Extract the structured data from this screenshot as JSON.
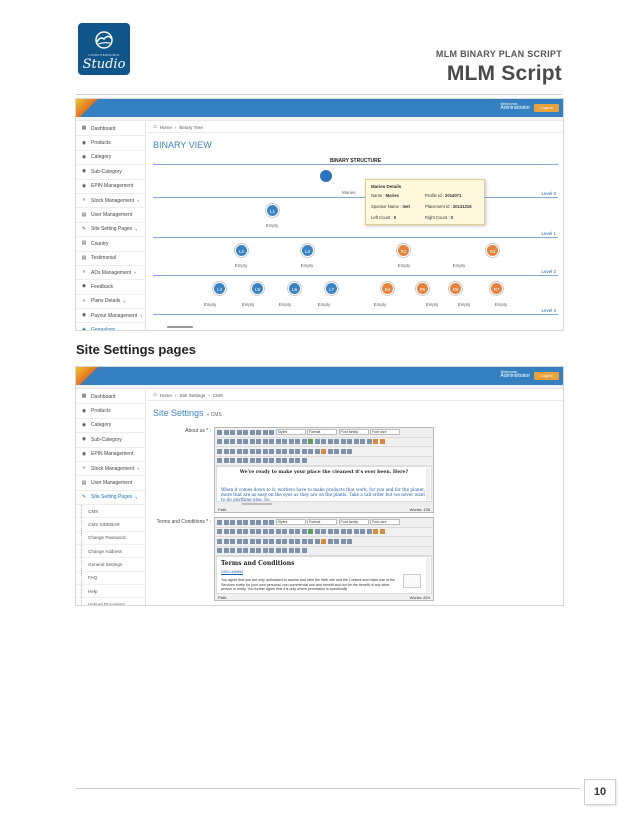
{
  "brand": {
    "company": "COMPUTERWORLD",
    "product": "Studio"
  },
  "header": {
    "subtitle": "MLM BINARY PLAN SCRIPT",
    "title": "MLM Script"
  },
  "topbar": {
    "welcome": "Welcome,",
    "user": "Administrator",
    "logout": "Logout"
  },
  "sidebar1": [
    {
      "icon": "dashboard-icon",
      "label": "Dashboard"
    },
    {
      "icon": "eye-icon",
      "label": "Products"
    },
    {
      "icon": "eye-icon",
      "label": "Category"
    },
    {
      "icon": "eye-icon",
      "label": "Sub-Category"
    },
    {
      "icon": "eye-icon",
      "label": "EPIN Management"
    },
    {
      "icon": "chevrons-icon",
      "label": "Stock Management",
      "caret": "˅"
    },
    {
      "icon": "list-icon",
      "label": "User Management"
    },
    {
      "icon": "edit-icon",
      "label": "Site Setting Pages",
      "caret": "˅"
    },
    {
      "icon": "list-icon",
      "label": "Country"
    },
    {
      "icon": "list-icon",
      "label": "Testimonial"
    },
    {
      "icon": "chevrons-icon",
      "label": "ADs Management",
      "caret": "˅"
    },
    {
      "icon": "tag-icon",
      "label": "Feedback"
    },
    {
      "icon": "chevrons-icon",
      "label": "Plans Details",
      "caret": "˅"
    },
    {
      "icon": "eye-icon",
      "label": "Payout Management",
      "caret": "˅"
    },
    {
      "icon": "eye-icon",
      "label": "Genealogy",
      "caret": "˅",
      "active": true
    }
  ],
  "binary": {
    "breadcrumb": {
      "home": "Home",
      "current": "Binary Tree"
    },
    "page_title": "BINARY VIEW",
    "structure_title": "BINARY STRUCTURE",
    "root_label": "Maries",
    "levels": [
      "Level 0",
      "Level 1",
      "Level 2",
      "Level 3"
    ],
    "empty": "Empty",
    "popup": {
      "title": "Maries Details",
      "name_label": "Name :",
      "name": "Maries",
      "profile_label": "Profile Id :",
      "profile": "2014071",
      "sponsor_label": "Sponsor Name :",
      "sponsor": "Inet",
      "placement_label": "Placement Id :",
      "placement": "20131216",
      "left_label": "Left Count :",
      "left": "0",
      "right_label": "Right Count :",
      "right": "0"
    },
    "nodes": {
      "l1": "L1",
      "l2": "L2",
      "l3": "L3",
      "r2": "R2",
      "r3": "R3",
      "l4": "L4",
      "l5": "L5",
      "l6": "L6",
      "l7": "L7",
      "r4": "R4",
      "r5": "R5",
      "r6": "R6",
      "r7": "R7"
    }
  },
  "section_title": "Site Settings pages",
  "sidebar2": [
    {
      "icon": "dashboard-icon",
      "label": "Dashboard"
    },
    {
      "icon": "eye-icon",
      "label": "Products"
    },
    {
      "icon": "eye-icon",
      "label": "Category"
    },
    {
      "icon": "eye-icon",
      "label": "Sub-Category"
    },
    {
      "icon": "eye-icon",
      "label": "EPIN Management"
    },
    {
      "icon": "chevrons-icon",
      "label": "Stock Management",
      "caret": "˅"
    },
    {
      "icon": "list-icon",
      "label": "User Management"
    },
    {
      "icon": "edit-icon",
      "label": "Site Setting Pages",
      "caret": "˅",
      "active": true
    }
  ],
  "sidebar2_sub": [
    "CMS",
    "CMS SIDEBAR",
    "Change Password",
    "Change Address",
    "General Settings",
    "FAQ",
    "Help",
    "Upload Document"
  ],
  "cms": {
    "breadcrumb": {
      "home": "Home",
      "mid": "Site Settings",
      "current": "CMS"
    },
    "page_title": "Site Settings",
    "page_sub": "» CMS",
    "about_label": "About us * :",
    "terms_label": "Terms and Conditions * :",
    "toolbar": {
      "styles": "Styles",
      "format": "Format",
      "font": "Font family",
      "size": "Font size"
    },
    "about_heading": "We're ready to make your place the cleanest it's ever been. Here?",
    "about_text": "When it comes down to it, workers have to make products that work, for you and for the planet, more that are as easy on the eyes as they are on the plants. Take a tall order but we never want to do anything else. So",
    "terms_heading": "Terms and Conditions",
    "disclaimer": "DISCLAIMER",
    "terms_text": "You agree that you are only authorised to access and view the Web site and the Content and make use of the Services solely for your own personal, non-commercial use and benefit and not for the benefit of any other person or entity. You further agree that it is only where permission is specifically",
    "path": "Path:",
    "about_words": "Words: 135",
    "terms_words": "Words: 824"
  },
  "page_number": "10"
}
